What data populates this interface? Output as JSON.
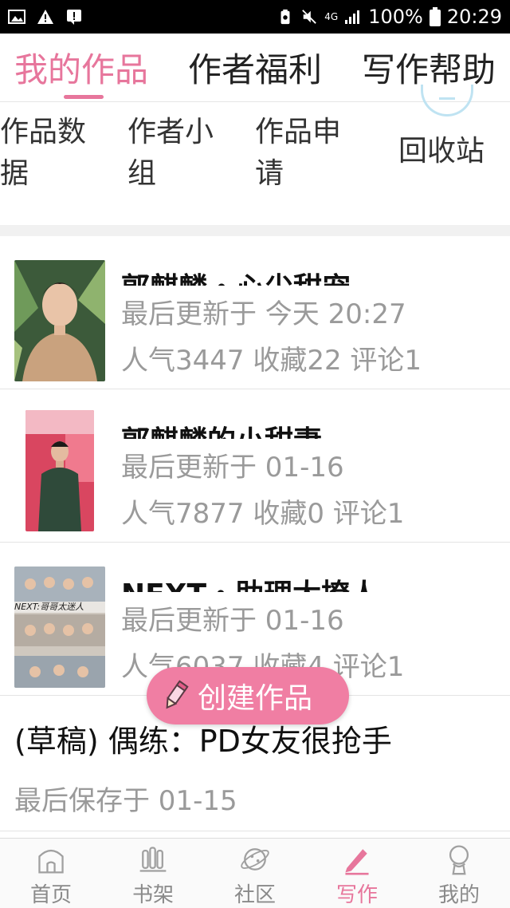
{
  "status_bar": {
    "network": "4G",
    "battery": "100%",
    "time": "20:29"
  },
  "top_tabs": [
    {
      "label": "我的作品",
      "active": true
    },
    {
      "label": "作者福利",
      "active": false
    },
    {
      "label": "写作帮助",
      "active": false
    }
  ],
  "tools": [
    {
      "line1": "作品数",
      "line2": "据"
    },
    {
      "line1": "作者小",
      "line2": "组"
    },
    {
      "line1": "作品申",
      "line2": "请"
    },
    {
      "line1": "回收站",
      "line2": ""
    }
  ],
  "works": [
    {
      "title": "郭麒麟・心尖甜宠",
      "updated": "最后更新于 今天 20:27",
      "stats": "人气3447 收藏22 评论1"
    },
    {
      "title": "郭麒麟的小甜妻",
      "updated": "最后更新于 01-16",
      "stats": "人气7877 收藏0 评论1"
    },
    {
      "title": "NEXT・助理太撩人",
      "updated": "最后更新于 01-16",
      "stats": "人气6037 收藏4 评论1",
      "cover_text": "NEXT:哥哥太迷人"
    }
  ],
  "draft": {
    "title": "(草稿) 偶练：PD女友很抢手",
    "saved": "最后保存于 01-15"
  },
  "create_button": {
    "label": "创建作品"
  },
  "bottom_nav": [
    {
      "label": "首页",
      "icon": "home-icon",
      "active": false
    },
    {
      "label": "书架",
      "icon": "bookshelf-icon",
      "active": false
    },
    {
      "label": "社区",
      "icon": "planet-icon",
      "active": false
    },
    {
      "label": "写作",
      "icon": "pen-icon",
      "active": true
    },
    {
      "label": "我的",
      "icon": "user-icon",
      "active": false
    }
  ],
  "colors": {
    "accent": "#e7769c",
    "create_button": "#f07ea3",
    "muted_text": "#9a9a9a"
  }
}
